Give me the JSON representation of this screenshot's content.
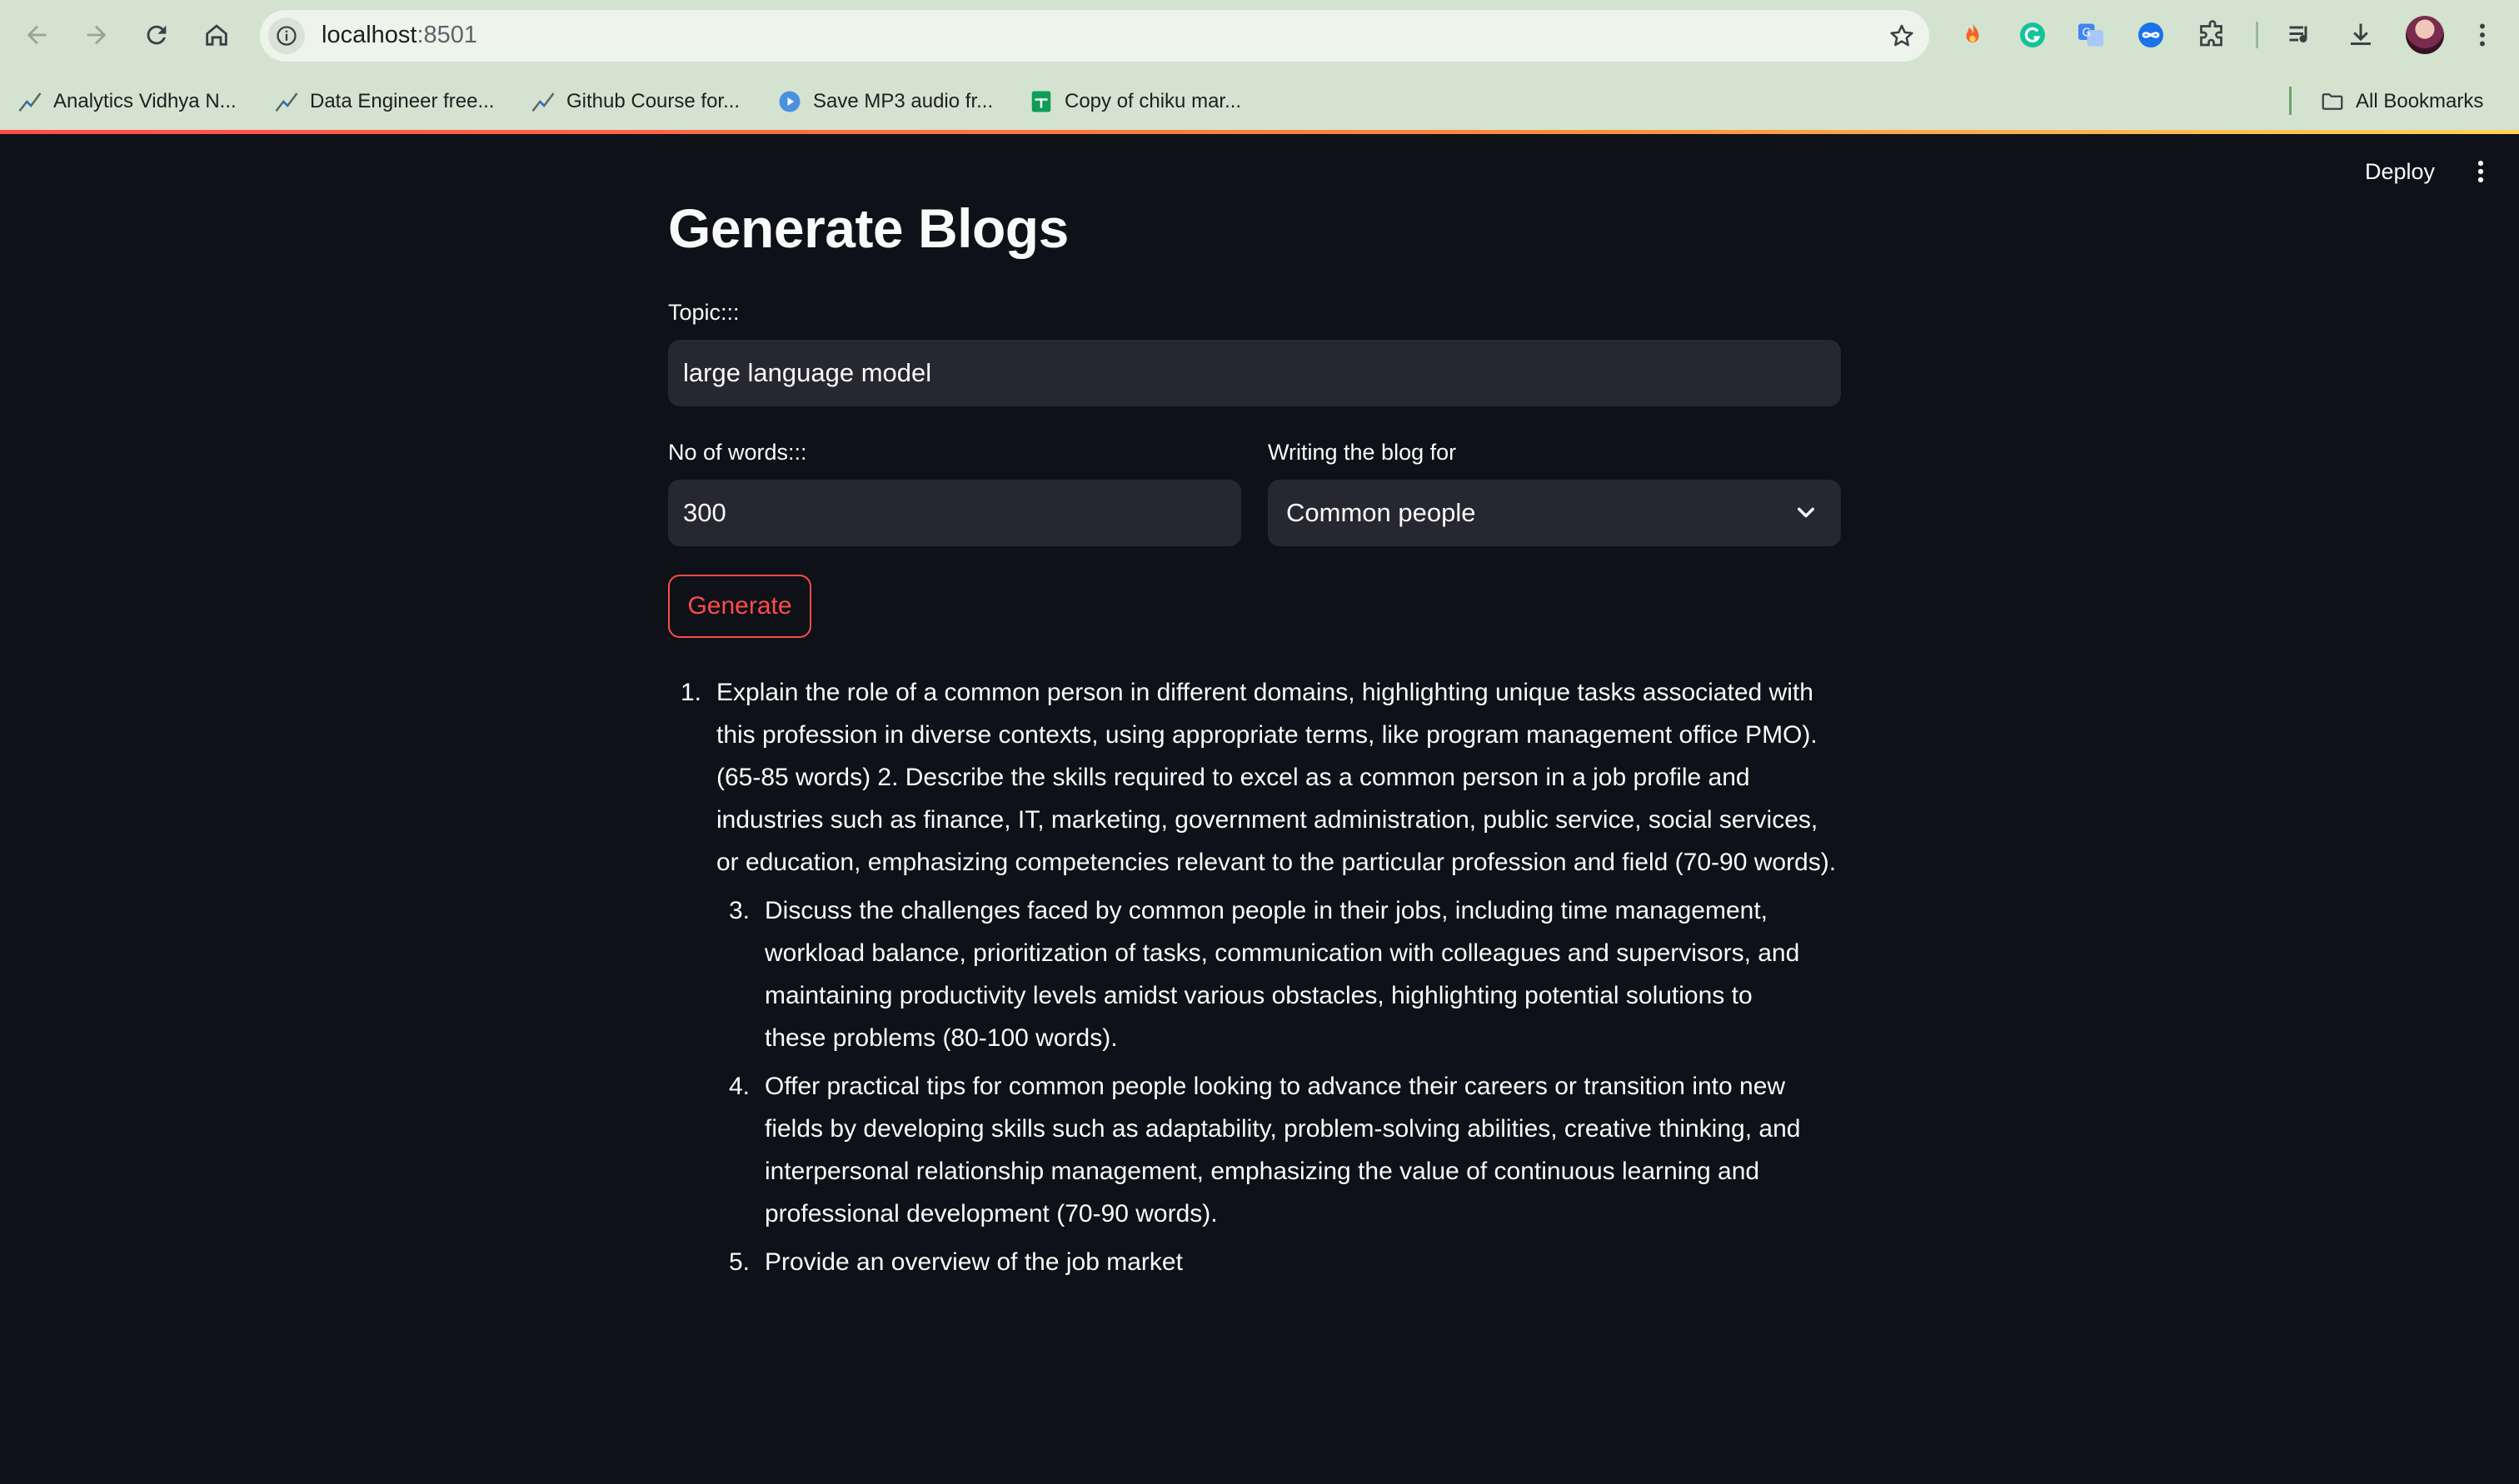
{
  "browser": {
    "url_host": "localhost",
    "url_port": ":8501",
    "bookmarks": [
      {
        "label": "Analytics Vidhya N...",
        "icon": "chart-trend-icon"
      },
      {
        "label": "Data Engineer free...",
        "icon": "chart-trend-icon"
      },
      {
        "label": "Github Course for...",
        "icon": "chart-trend-icon"
      },
      {
        "label": "Save MP3 audio fr...",
        "icon": "play-circle-icon"
      },
      {
        "label": "Copy of chiku mar...",
        "icon": "sheets-icon"
      }
    ],
    "all_bookmarks_label": "All Bookmarks"
  },
  "header": {
    "deploy_label": "Deploy"
  },
  "page": {
    "title": "Generate Blogs",
    "topic_label": "Topic:::",
    "topic_value": "large language model",
    "words_label": "No of words:::",
    "words_value": "300",
    "audience_label": "Writing the blog for",
    "audience_value": "Common people",
    "generate_label": "Generate"
  },
  "result": {
    "items": [
      {
        "num": "1.",
        "lines": [
          "Explain the role of a common person in different domains, highlighting unique tasks associated with",
          "this profession in diverse contexts, using appropriate terms, like program management office PMO).",
          "(65-85 words) 2. Describe the skills required to excel as a common person in a job profile and",
          "industries such as finance, IT, marketing, government administration, public service, social services,",
          "or education, emphasizing competencies relevant to the particular profession and field (70-90 words)."
        ]
      },
      {
        "num": "3.",
        "lines": [
          "Discuss the challenges faced by common people in their jobs, including time management,",
          "workload balance, prioritization of tasks, communication with colleagues and supervisors, and",
          "maintaining productivity levels amidst various obstacles, highlighting potential solutions to",
          "these problems (80-100 words)."
        ]
      },
      {
        "num": "4.",
        "lines": [
          "Offer practical tips for common people looking to advance their careers or transition into new",
          "fields by developing skills such as adaptability, problem-solving abilities, creative thinking, and",
          "interpersonal relationship management, emphasizing the value of continuous learning and",
          "professional development (70-90 words)."
        ]
      },
      {
        "num": "5.",
        "lines": [
          "Provide an overview of the job market"
        ]
      }
    ]
  },
  "colors": {
    "chrome_bg": "#d3e3cf",
    "app_bg": "#0e1117",
    "input_bg": "#262730",
    "accent": "#ff4b4b"
  }
}
